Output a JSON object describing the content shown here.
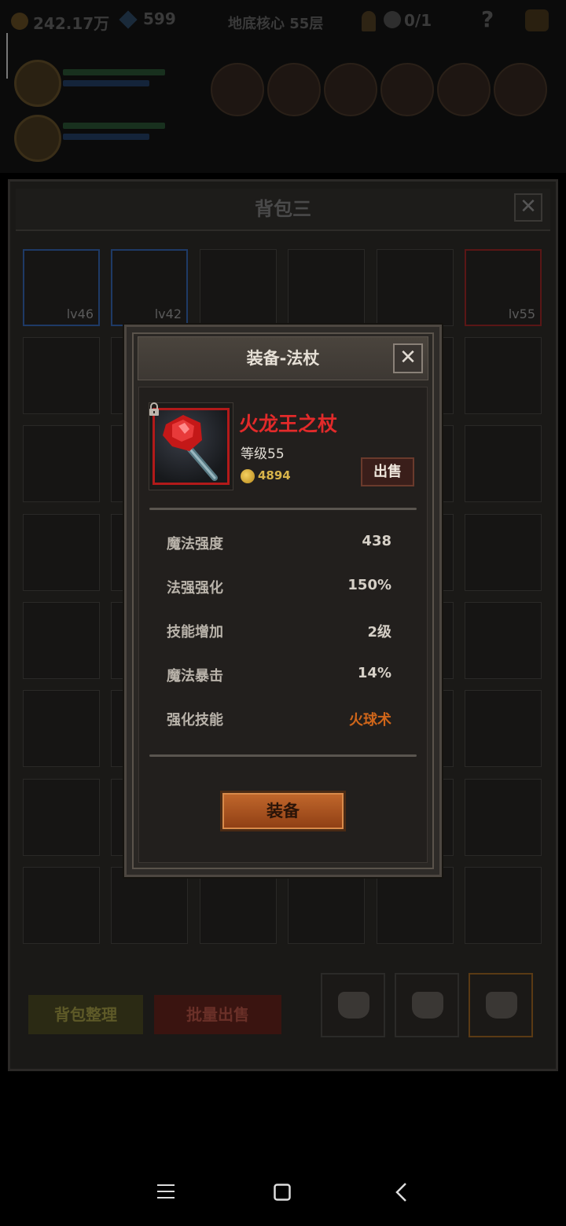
{
  "hud": {
    "gold": "242.17万",
    "gems": "599",
    "floor": "地底核心 55层",
    "keys": "0/1",
    "help": "?"
  },
  "bag": {
    "title": "背包三",
    "close_label": "✕",
    "filled_slots": [
      {
        "level": "lv46",
        "rarity": "blue"
      },
      {
        "level": "lv42",
        "rarity": "blue"
      },
      {
        "level": "lv55",
        "rarity": "red"
      }
    ],
    "sort_button": "背包整理",
    "bulk_sell_button": "批量出售"
  },
  "dialog": {
    "title": "装备-法杖",
    "close_label": "✕",
    "item": {
      "name": "火龙王之杖",
      "level": "等级55",
      "price": "4894",
      "sell_label": "出售"
    },
    "stats": [
      {
        "label": "魔法强度",
        "value": "438"
      },
      {
        "label": "法强强化",
        "value": "150%"
      },
      {
        "label": "技能增加",
        "value": "2级"
      },
      {
        "label": "魔法暴击",
        "value": "14%"
      },
      {
        "label": "强化技能",
        "value": "火球术"
      }
    ],
    "equip_label": "装备"
  },
  "colors": {
    "item_name": "#e22a2a",
    "highlight_value": "#d0661a",
    "equip_button": "#c2682c"
  }
}
